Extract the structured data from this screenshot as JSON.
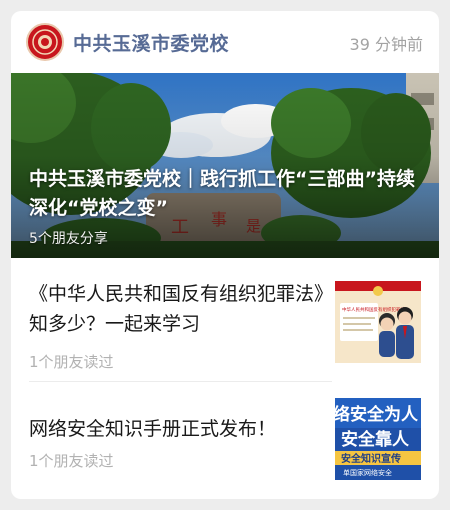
{
  "account": {
    "name": "中共玉溪市委党校",
    "time": "39 分钟前"
  },
  "hero": {
    "title": "中共玉溪市委党校｜践行抓工作“三部曲”持续深化“党校之变”",
    "shares": "5个朋友分享"
  },
  "articles": [
    {
      "title": "《中华人民共和国反有组织犯罪法》知多少？一起来学习",
      "meta": "1个朋友读过"
    },
    {
      "title": "网络安全知识手册正式发布！",
      "meta": "1个朋友读过"
    }
  ],
  "thumbnails": {
    "law_poster_text": "中华人民共和国反有组织犯罪法",
    "security_banner": {
      "line1": "络安全为人",
      "line2": "安全靠人",
      "line3": "安全知识宣传",
      "line4": "单国家网络安全"
    }
  },
  "colors": {
    "account": "#576b95",
    "logo": "#c8161d",
    "banner": "#1f50a8"
  }
}
